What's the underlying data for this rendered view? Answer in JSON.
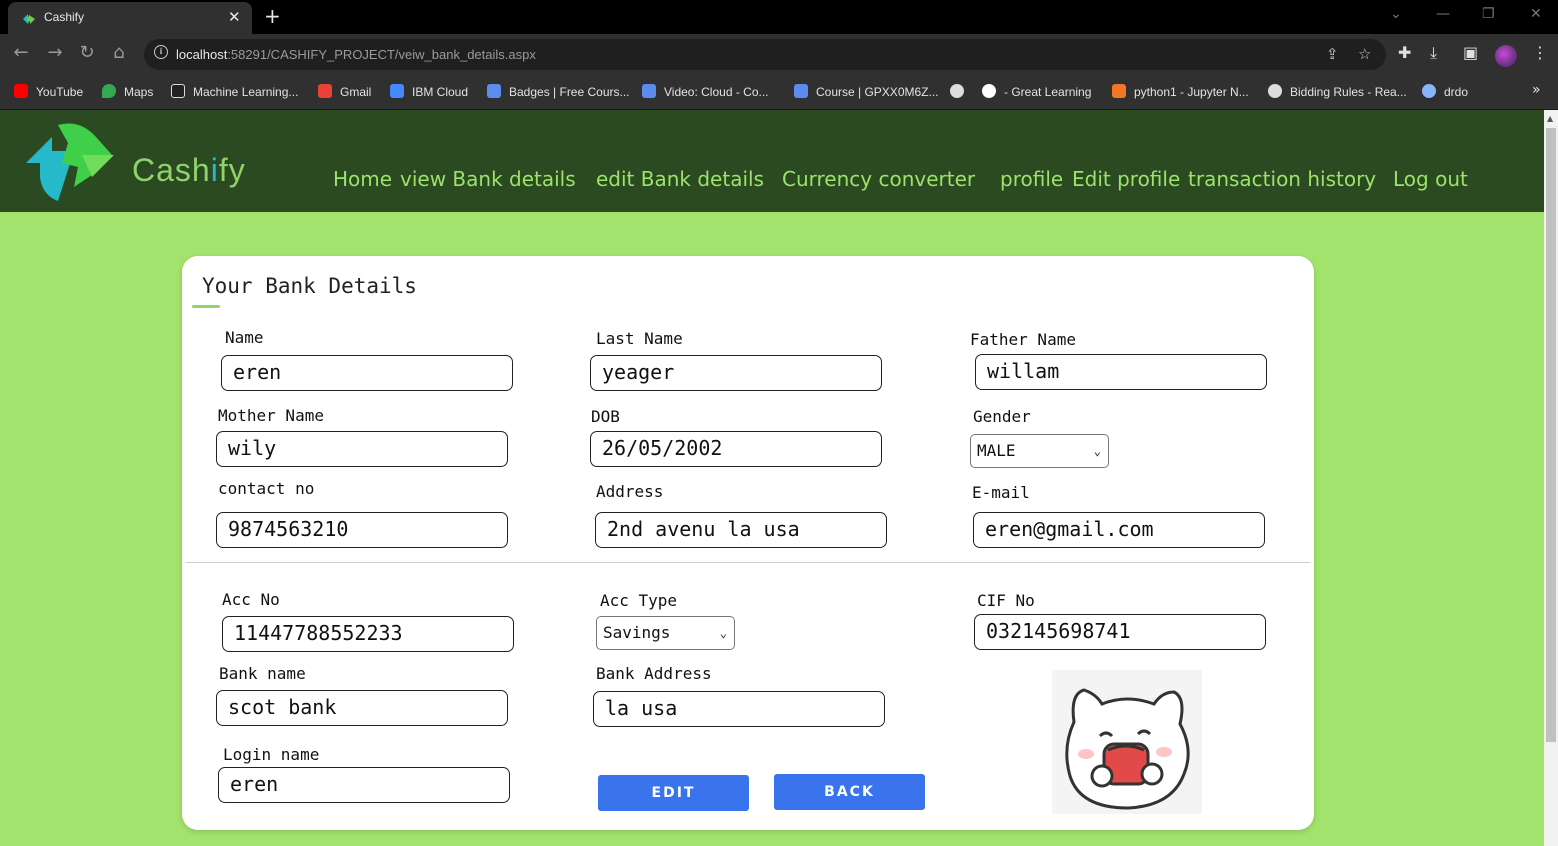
{
  "browser": {
    "tab_title": "Cashify",
    "url_host": "localhost",
    "url_rest": ":58291/CASHIFY_PROJECT/veiw_bank_details.aspx",
    "bookmarks": [
      "YouTube",
      "Maps",
      "Machine Learning...",
      "Gmail",
      "IBM Cloud",
      "Badges | Free Cours...",
      "Video: Cloud - Co...",
      "Course | GPXX0M6Z...",
      "- Great Learning",
      "python1 - Jupyter N...",
      "Bidding Rules - Rea...",
      "drdo"
    ]
  },
  "site": {
    "logo_pre": "Cash",
    "logo_i": "i",
    "logo_post": "fy",
    "nav": [
      "Home",
      "view Bank details",
      "edit Bank details",
      "Currency converter",
      "profile",
      "Edit profile",
      "transaction history",
      "Log out"
    ]
  },
  "card": {
    "title": "Your Bank Details",
    "fields": {
      "name": {
        "label": "Name",
        "value": "eren"
      },
      "last_name": {
        "label": "Last Name",
        "value": "yeager"
      },
      "father_name": {
        "label": "Father Name",
        "value": "willam"
      },
      "mother_name": {
        "label": "Mother Name",
        "value": "wily"
      },
      "dob": {
        "label": "DOB",
        "value": "26/05/2002"
      },
      "gender": {
        "label": "Gender",
        "value": "MALE"
      },
      "contact": {
        "label": "contact no",
        "value": "9874563210"
      },
      "address": {
        "label": "Address",
        "value": "2nd avenu la usa"
      },
      "email": {
        "label": "E-mail",
        "value": "eren@gmail.com"
      },
      "acc_no": {
        "label": "Acc No",
        "value": "11447788552233"
      },
      "acc_type": {
        "label": "Acc Type",
        "value": "Savings"
      },
      "cif_no": {
        "label": "CIF No",
        "value": "032145698741"
      },
      "bank_name": {
        "label": "Bank name",
        "value": "scot bank"
      },
      "bank_address": {
        "label": "Bank Address",
        "value": "la usa"
      },
      "login_name": {
        "label": "Login name",
        "value": "eren"
      }
    },
    "edit_button": "EDIT",
    "back_button": "BACK"
  },
  "colors": {
    "page_bg": "#a3e36d",
    "header_bg": "#2b4a22",
    "nav_text": "#9be36a",
    "button": "#3a74ec"
  }
}
